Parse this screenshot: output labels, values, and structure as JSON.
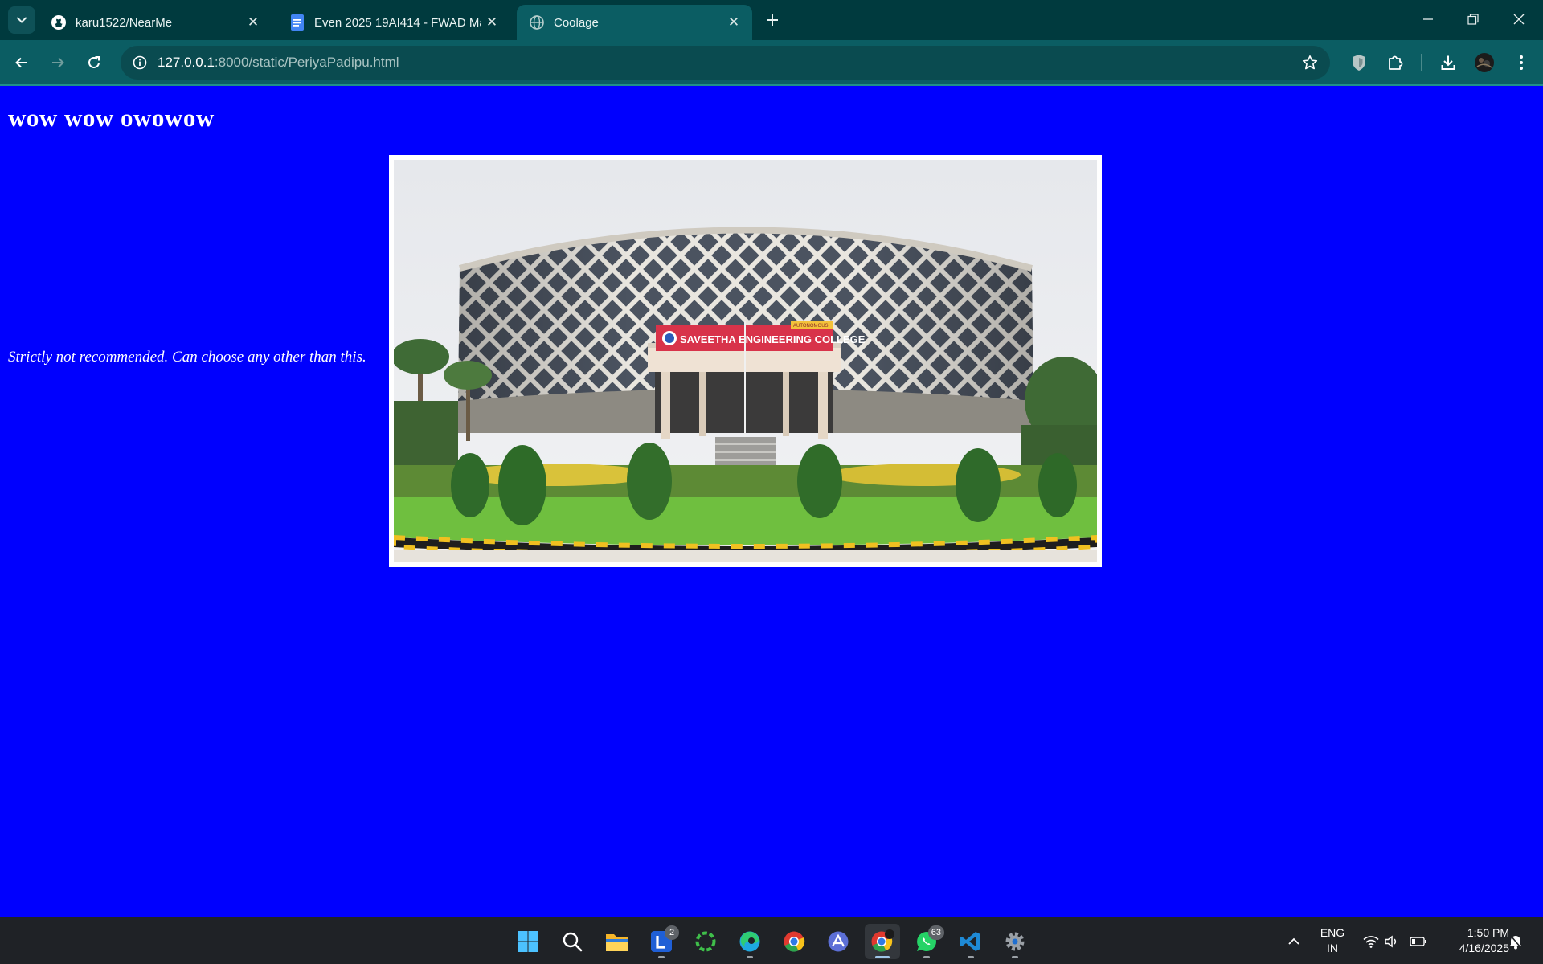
{
  "browser": {
    "tabs": [
      {
        "title": "karu1522/NearMe",
        "icon": "github-icon",
        "active": false
      },
      {
        "title": "Even 2025 19AI414 - FWAD Ma",
        "icon": "google-docs-icon",
        "active": false
      },
      {
        "title": "Coolage",
        "icon": "globe-icon",
        "active": true
      }
    ],
    "address": {
      "host": "127.0.0.1",
      "path": ":8000/static/PeriyaPadipu.html"
    },
    "colors": {
      "frame": "#003a3e",
      "toolbar": "#0b5d63",
      "omnibox": "#0a4b50"
    }
  },
  "page": {
    "heading": "wow wow owowow",
    "caption": "Strictly not recommended. Can choose any other than this.",
    "image": {
      "sign_text": "SAVEETHA ENGINEERING COLLEGE",
      "sign_tag": "AUTONOMOUS"
    },
    "background_color": "#0000fe"
  },
  "taskbar": {
    "apps": [
      {
        "name": "start-button"
      },
      {
        "name": "search-button"
      },
      {
        "name": "file-explorer"
      },
      {
        "name": "launcher-app",
        "badge": "2"
      },
      {
        "name": "sync-app"
      },
      {
        "name": "edge-browser"
      },
      {
        "name": "chrome-browser"
      },
      {
        "name": "arc-app"
      },
      {
        "name": "chrome-profile-active"
      },
      {
        "name": "whatsapp",
        "badge": "63"
      },
      {
        "name": "vscode"
      },
      {
        "name": "settings"
      }
    ],
    "tray": {
      "language_top": "ENG",
      "language_bottom": "IN",
      "time": "1:50 PM",
      "date": "4/16/2025"
    }
  }
}
